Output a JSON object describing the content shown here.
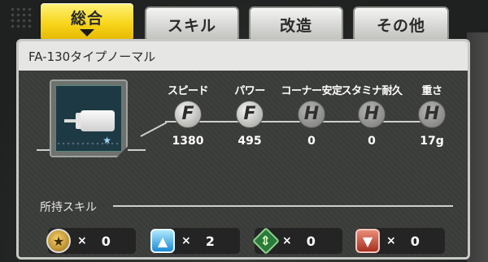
{
  "tabs": [
    {
      "label": "総合",
      "active": true
    },
    {
      "label": "スキル",
      "active": false
    },
    {
      "label": "改造",
      "active": false
    },
    {
      "label": "その他",
      "active": false
    }
  ],
  "panel": {
    "title": "FA-130タイプノーマル"
  },
  "part_icon": "motor-icon",
  "stats": [
    {
      "label": "スピード",
      "grade": "F",
      "value": "1380"
    },
    {
      "label": "パワー",
      "grade": "F",
      "value": "495"
    },
    {
      "label": "コーナー安定",
      "grade": "H",
      "value": "0"
    },
    {
      "label": "スタミナ耐久",
      "grade": "H",
      "value": "0"
    },
    {
      "label": "重さ",
      "grade": "H",
      "value": "17g"
    }
  ],
  "skills": {
    "label": "所持スキル",
    "items": [
      {
        "icon": "star-icon",
        "times": "×",
        "count": "0"
      },
      {
        "icon": "up-arrow-icon",
        "times": "×",
        "count": "2"
      },
      {
        "icon": "diamond-icon",
        "times": "×",
        "count": "0"
      },
      {
        "icon": "down-arrow-icon",
        "times": "×",
        "count": "0"
      }
    ]
  },
  "colors": {
    "active_tab": "#f7d51a",
    "panel_header": "#e6e7e4",
    "panel_body": "#3a3c39"
  }
}
